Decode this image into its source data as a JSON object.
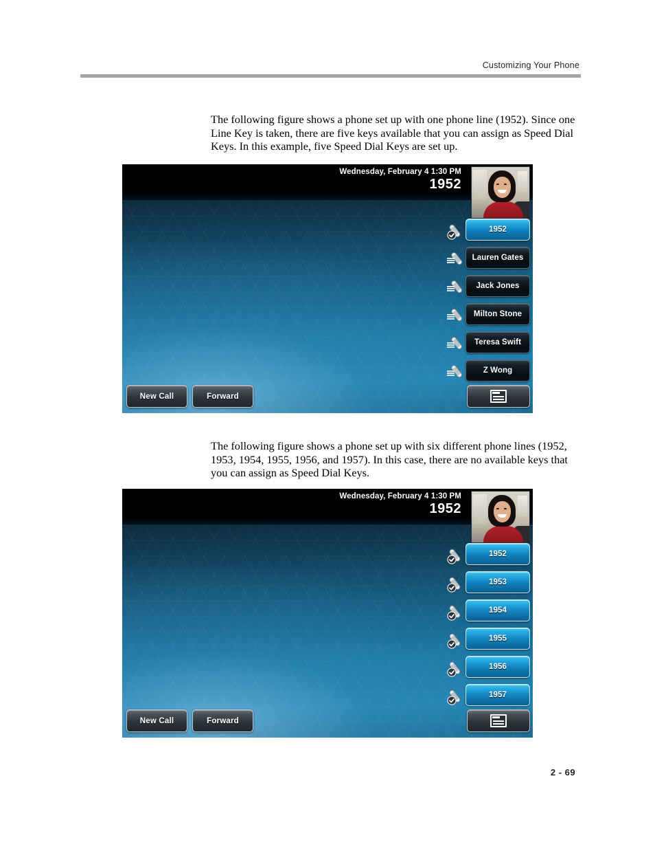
{
  "header": {
    "running_head": "Customizing Your Phone"
  },
  "paragraphs": {
    "first": "The following figure shows a phone set up with one phone line (1952). Since one Line Key is taken, there are five keys available that you can assign as Speed Dial Keys. In this example, five Speed Dial Keys are set up.",
    "second": "The following figure shows a phone set up with six different phone lines (1952, 1953, 1954, 1955, 1956, and 1957). In this case, there are no available keys that you can assign as Speed Dial Keys."
  },
  "figure_one": {
    "status_bar": {
      "datetime": "Wednesday, February 4  1:30 PM",
      "extension": "1952"
    },
    "avatar_icon": "user-photo",
    "keys": [
      {
        "label": "1952",
        "state": "line",
        "icon": "registered-line-icon"
      },
      {
        "label": "Lauren Gates",
        "state": "speed-dial",
        "icon": "speed-dial-icon"
      },
      {
        "label": "Jack Jones",
        "state": "speed-dial",
        "icon": "speed-dial-icon"
      },
      {
        "label": "Milton Stone",
        "state": "speed-dial",
        "icon": "speed-dial-icon"
      },
      {
        "label": "Teresa Swift",
        "state": "speed-dial",
        "icon": "speed-dial-icon"
      },
      {
        "label": "Z Wong",
        "state": "speed-dial",
        "icon": "speed-dial-icon"
      }
    ],
    "softkeys": {
      "new_call": "New Call",
      "forward": "Forward",
      "menu_icon": "menu-list-icon"
    }
  },
  "figure_two": {
    "status_bar": {
      "datetime": "Wednesday, February 4  1:30 PM",
      "extension": "1952"
    },
    "avatar_icon": "user-photo",
    "keys": [
      {
        "label": "1952",
        "state": "line",
        "icon": "registered-line-icon"
      },
      {
        "label": "1953",
        "state": "line",
        "icon": "registered-line-icon"
      },
      {
        "label": "1954",
        "state": "line",
        "icon": "registered-line-icon"
      },
      {
        "label": "1955",
        "state": "line",
        "icon": "registered-line-icon"
      },
      {
        "label": "1956",
        "state": "line",
        "icon": "registered-line-icon"
      },
      {
        "label": "1957",
        "state": "line",
        "icon": "registered-line-icon"
      }
    ],
    "softkeys": {
      "new_call": "New Call",
      "forward": "Forward",
      "menu_icon": "menu-list-icon"
    }
  },
  "footer": {
    "page_number": "2 - 69"
  },
  "colors": {
    "rule": "#a6a6a6",
    "active_key_blue": "#1b8ec4",
    "idle_key_dark": "#0b1117",
    "status_bar": "#000000",
    "text": "#231f20"
  }
}
